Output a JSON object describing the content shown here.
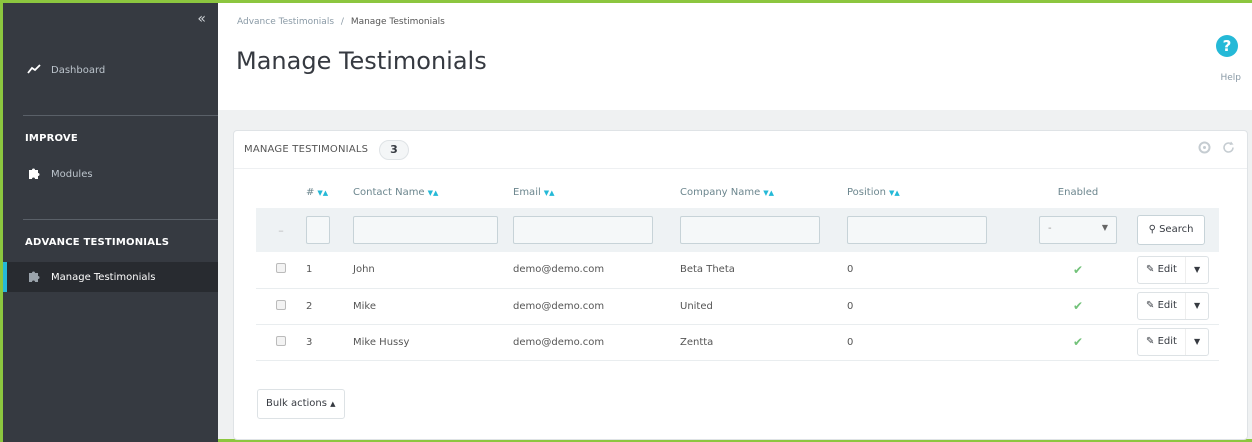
{
  "sidebar": {
    "collapse_icon": "«",
    "dashboard_label": "Dashboard",
    "improve_heading": "IMPROVE",
    "modules_label": "Modules",
    "section_heading": "ADVANCE TESTIMONIALS",
    "manage_label": "Manage Testimonials"
  },
  "header": {
    "breadcrumb_parent": "Advance Testimonials",
    "breadcrumb_sep": "/",
    "breadcrumb_current": "Manage Testimonials",
    "title": "Manage Testimonials",
    "help_icon_glyph": "?",
    "help_label": "Help"
  },
  "panel": {
    "title": "MANAGE TESTIMONIALS",
    "count": "3",
    "columns": {
      "id": "#",
      "contact": "Contact Name",
      "email": "Email",
      "company": "Company Name",
      "position": "Position",
      "enabled": "Enabled"
    },
    "filter": {
      "enabled_value": "-",
      "search_label": "Search"
    },
    "rows": [
      {
        "id": "1",
        "contact": "John",
        "email": "demo@demo.com",
        "company": "Beta Theta",
        "position": "0",
        "enabled": true,
        "edit": "Edit"
      },
      {
        "id": "2",
        "contact": "Mike",
        "email": "demo@demo.com",
        "company": "United",
        "position": "0",
        "enabled": true,
        "edit": "Edit"
      },
      {
        "id": "3",
        "contact": "Mike Hussy",
        "email": "demo@demo.com",
        "company": "Zentta",
        "position": "0",
        "enabled": true,
        "edit": "Edit"
      }
    ],
    "bulk_label": "Bulk actions"
  },
  "colors": {
    "accent": "#25b9d7",
    "frame_border": "#8cc63f",
    "sidebar_bg": "#363a41",
    "enabled_tick": "#72c279"
  }
}
